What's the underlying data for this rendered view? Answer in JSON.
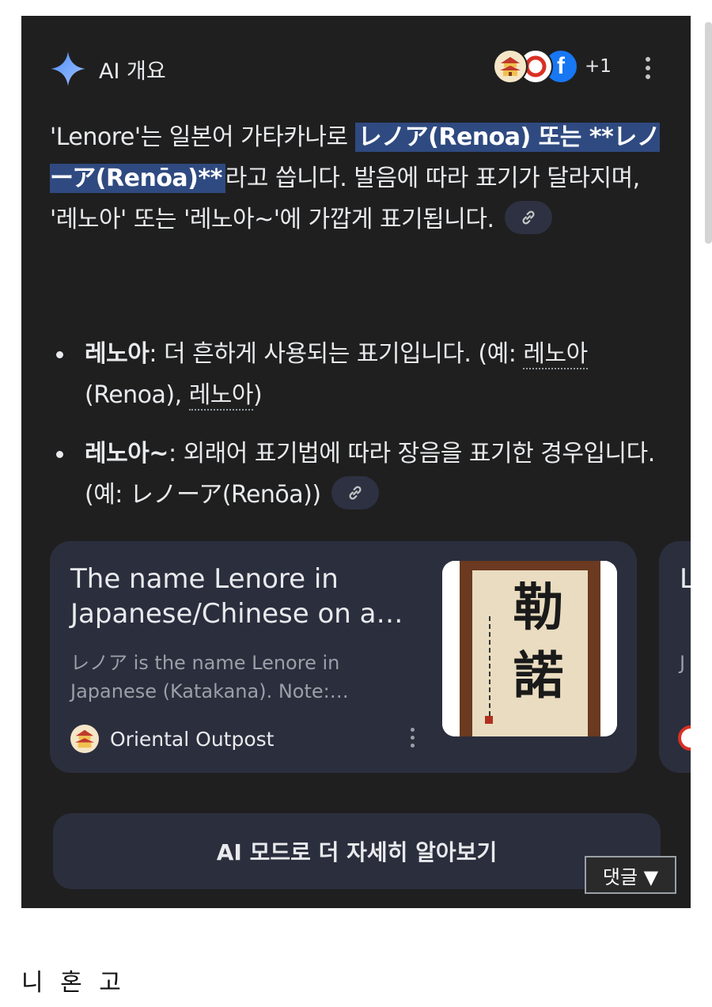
{
  "header": {
    "title": "AI 개요",
    "sparkle_icon": "gemini-sparkle-icon",
    "sources_more": "+1"
  },
  "overview": {
    "p_before": "'Lenore'는 일본어 가타카나로 ",
    "p_highlight": "レノア(Renoa) 또는 **レノーア(Renōa)**",
    "p_after": "라고 씁니다. 발음에 따라 표기가 달라지며, '레노아' 또는 '레노아~'에 가깝게 표기됩니다. "
  },
  "bullets": [
    {
      "bold": "레노아",
      "pre": ": 더 흔하게 사용되는 표기입니다. (예: ",
      "link1": "레노아",
      "mid": "(Renoa), ",
      "link2": "레노아",
      "post": ")"
    },
    {
      "bold": "레노아~",
      "text": ": 외래어 표기법에 따라 장음을 표기한 경우입니다. (예: レノーア(Renōa)) "
    }
  ],
  "cards": [
    {
      "title": "The name Lenore in Japanese/Chinese on a…",
      "description": "レノア is the name Lenore in Japanese (Katakana). Note:…",
      "source": "Oriental Outpost",
      "image_chars": "勒 諾"
    },
    {
      "title_partial": "L F",
      "desc_partial": "J ア"
    }
  ],
  "ai_mode_button": "AI 모드로 더 자세히 알아보기",
  "comment_button": "댓글 ▼",
  "caption": "니 혼 고",
  "colors": {
    "panel": "#1f1f1f",
    "card": "#2b2e3d",
    "highlight": "#2f4a80",
    "text": "#e8eaed",
    "muted": "#9aa0a6"
  }
}
